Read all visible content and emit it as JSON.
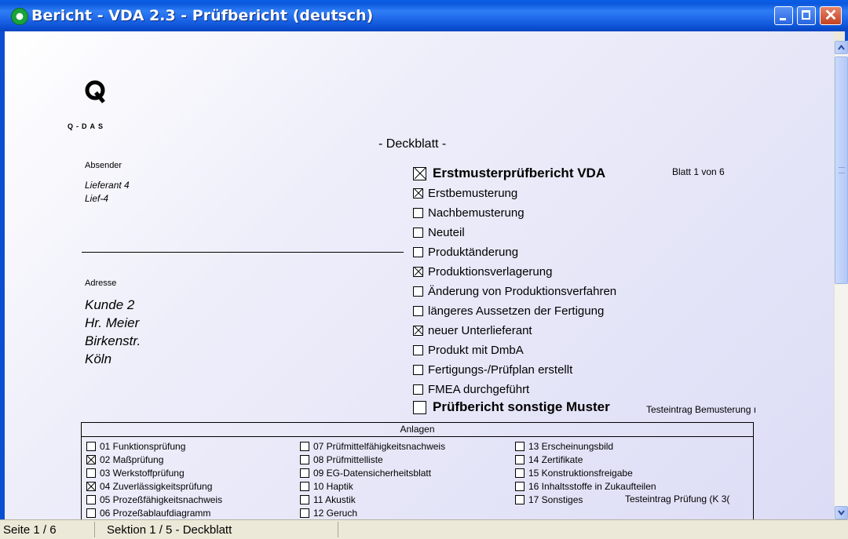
{
  "window": {
    "title": "Bericht - VDA 2.3 - Prüfbericht (deutsch)"
  },
  "report": {
    "logo_text": "Q-DAS",
    "section_title": "- Deckblatt -",
    "sender_label": "Absender",
    "sender_lines": [
      "Lieferant 4",
      "Lief-4"
    ],
    "address_label": "Adresse",
    "address_lines": [
      "Kunde 2",
      "Hr. Meier",
      "Birkenstr.",
      "Köln"
    ],
    "main_check": {
      "label": "Erstmusterprüfbericht VDA",
      "checked": true
    },
    "sheet": "Blatt  1  von  6",
    "checks": [
      {
        "label": "Erstbemusterung",
        "checked": true
      },
      {
        "label": "Nachbemusterung",
        "checked": false
      },
      {
        "label": "Neuteil",
        "checked": false
      },
      {
        "label": "Produktänderung",
        "checked": false
      },
      {
        "label": "Produktionsverlagerung",
        "checked": true
      },
      {
        "label": "Änderung von Produktionsverfahren",
        "checked": false
      },
      {
        "label": "längeres Aussetzen der Fertigung",
        "checked": false
      },
      {
        "label": "neuer Unterlieferant",
        "checked": true
      },
      {
        "label": "Produkt mit DmbA",
        "checked": false
      },
      {
        "label": "Fertigungs-/Prüfplan erstellt",
        "checked": false
      },
      {
        "label": "FMEA durchgeführt",
        "checked": false
      }
    ],
    "other_check": {
      "label": "Prüfbericht sonstige Muster",
      "checked": false
    },
    "other_note": "Testeintrag Bemusterung ı",
    "attachments_title": "Anlagen",
    "attachments": [
      {
        "label": "01 Funktionsprüfung",
        "checked": false
      },
      {
        "label": "02 Maßprüfung",
        "checked": true
      },
      {
        "label": "03 Werkstoffprüfung",
        "checked": false
      },
      {
        "label": "04 Zuverlässigkeitsprüfung",
        "checked": true
      },
      {
        "label": "05 Prozeßfähigkeitsnachweis",
        "checked": false
      },
      {
        "label": "06 Prozeßablaufdiagramm",
        "checked": false
      },
      {
        "label": "07 Prüfmittelfähigkeitsnachweis",
        "checked": false
      },
      {
        "label": "08 Prüfmittelliste",
        "checked": false
      },
      {
        "label": "09 EG-Datensicherheitsblatt",
        "checked": false
      },
      {
        "label": "10 Haptik",
        "checked": false
      },
      {
        "label": "11 Akustik",
        "checked": false
      },
      {
        "label": "12 Geruch",
        "checked": false
      },
      {
        "label": "13 Erscheinungsbild",
        "checked": false
      },
      {
        "label": "14 Zertifikate",
        "checked": false
      },
      {
        "label": "15 Konstruktionsfreigabe",
        "checked": false
      },
      {
        "label": "16 Inhaltsstoffe in Zukaufteilen",
        "checked": false
      },
      {
        "label": "17 Sonstiges",
        "checked": false
      }
    ],
    "attachments_note": "Testeintrag Prüfung (K 3("
  },
  "status": {
    "page": "Seite 1 / 6",
    "section": "Sektion 1 / 5 - Deckblatt"
  }
}
